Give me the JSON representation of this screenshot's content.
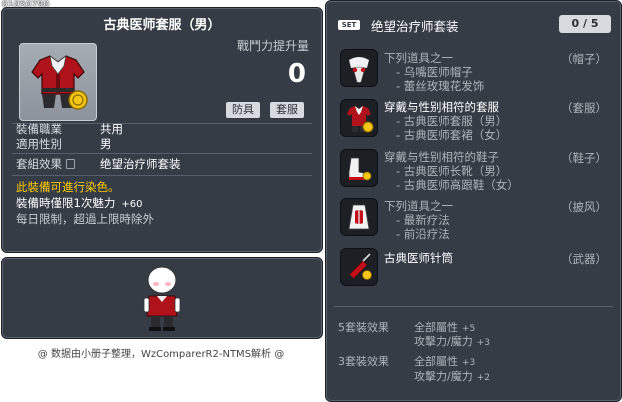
{
  "item_id": "01050790",
  "item": {
    "name": "古典医师套服（男）",
    "power_label": "戰鬥力提升量",
    "power_value": "0",
    "tags": [
      "防具",
      "套服"
    ],
    "job_label": "裝備職業",
    "job_value": "共用",
    "gender_label": "適用性別",
    "gender_value": "男",
    "set_label": "套組效果",
    "set_value": "绝望治疗师套装",
    "dye_text": "此裝備可進行染色。",
    "charm_text": "裝備時僅限1次魅力",
    "charm_value": "+60",
    "limit_text": "每日限制，超過上限時除外"
  },
  "credit": "@ 数据由小册子整理，WzComparerR2-NTMS解析 @",
  "set": {
    "badge": "SET",
    "name": "绝望治疗师套装",
    "count": "0 / 5",
    "pieces": [
      {
        "head": "下列道具之一",
        "options": [
          "- 乌嘴医师帽子",
          "- 蕾丝玫瑰花发饰"
        ],
        "category": "（帽子）",
        "icon": "plague-mask-icon"
      },
      {
        "head": "穿戴与性别相符的套服",
        "options": [
          "- 古典医师套服（男）",
          "- 古典医师套裙（女）"
        ],
        "category": "（套服）",
        "icon": "overall-icon"
      },
      {
        "head": "穿戴与性别相符的鞋子",
        "options": [
          "- 古典医师长靴（男）",
          "- 古典医师高跟鞋（女）"
        ],
        "category": "（鞋子）",
        "icon": "shoes-icon"
      },
      {
        "head": "下列道具之一",
        "options": [
          "- 最新疗法",
          "- 前沿疗法"
        ],
        "category": "（披风）",
        "icon": "cape-icon"
      },
      {
        "head": "古典医师针筒",
        "options": [],
        "category": "（武器）",
        "icon": "syringe-icon"
      }
    ],
    "effects": [
      {
        "label": "5套裝效果",
        "stats": [
          {
            "name": "全部屬性",
            "value": "+5"
          },
          {
            "name": "攻擊力/魔力",
            "value": "+3"
          }
        ]
      },
      {
        "label": "3套裝效果",
        "stats": [
          {
            "name": "全部屬性",
            "value": "+3"
          },
          {
            "name": "攻擊力/魔力",
            "value": "+2"
          }
        ]
      }
    ]
  },
  "colors": {
    "panel_bg": "#353c46",
    "dye_text": "#ffcc00",
    "dim_text": "#aeb4bb",
    "tag_bg": "#d7dade"
  }
}
